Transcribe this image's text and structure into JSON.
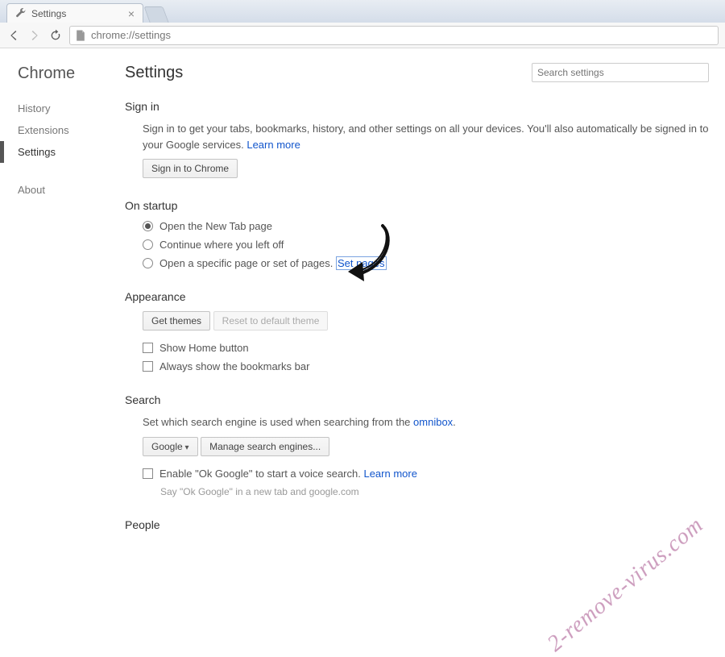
{
  "tab": {
    "title": "Settings"
  },
  "omnibox": {
    "url": "chrome://settings"
  },
  "sidebar": {
    "title": "Chrome",
    "items": [
      {
        "label": "History"
      },
      {
        "label": "Extensions"
      },
      {
        "label": "Settings",
        "active": true
      },
      {
        "label": "About"
      }
    ]
  },
  "header": {
    "title": "Settings",
    "search_placeholder": "Search settings"
  },
  "signin": {
    "heading": "Sign in",
    "text_a": "Sign in to get your tabs, bookmarks, history, and other settings on all your devices. You'll also automatically be signed in to your Google services. ",
    "learn_more": "Learn more",
    "button": "Sign in to Chrome"
  },
  "startup": {
    "heading": "On startup",
    "opt1": "Open the New Tab page",
    "opt2": "Continue where you left off",
    "opt3": "Open a specific page or set of pages. ",
    "set_pages": "Set pages"
  },
  "appearance": {
    "heading": "Appearance",
    "get_themes": "Get themes",
    "reset_theme": "Reset to default theme",
    "show_home": "Show Home button",
    "show_bookmarks": "Always show the bookmarks bar"
  },
  "search": {
    "heading": "Search",
    "text_a": "Set which search engine is used when searching from the ",
    "omnibox_link": "omnibox",
    "engine_button": "Google",
    "manage_button": "Manage search engines...",
    "ok_google_a": "Enable \"Ok Google\" to start a voice search. ",
    "ok_google_learn": "Learn more",
    "ok_google_helper": "Say \"Ok Google\" in a new tab and google.com"
  },
  "people": {
    "heading": "People"
  },
  "watermark": "2-remove-virus.com"
}
